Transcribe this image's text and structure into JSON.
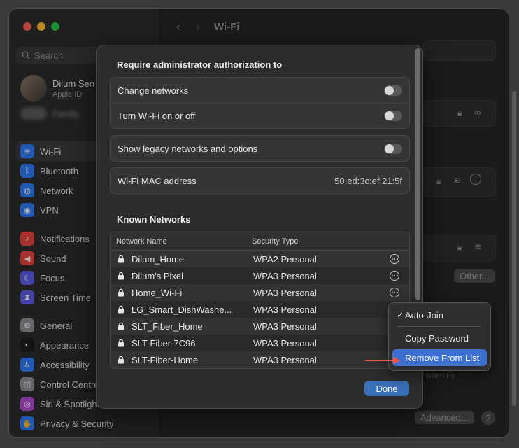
{
  "window": {
    "title": "Wi-Fi"
  },
  "sidebar": {
    "search_placeholder": "Search",
    "account": {
      "name": "Dilum Sen",
      "sub": "Apple ID"
    },
    "family": "Family",
    "groups": [
      [
        {
          "label": "Wi-Fi",
          "icon": "wifi-icon",
          "color": "#2e7bf6",
          "glyph": "≋",
          "active": true
        },
        {
          "label": "Bluetooth",
          "icon": "bluetooth-icon",
          "color": "#2e7bf6",
          "glyph": "ᛒ"
        },
        {
          "label": "Network",
          "icon": "globe-icon",
          "color": "#2e7bf6",
          "glyph": "◍"
        },
        {
          "label": "VPN",
          "icon": "vpn-icon",
          "color": "#2e7bf6",
          "glyph": "◉"
        }
      ],
      [
        {
          "label": "Notifications",
          "icon": "bell-icon",
          "color": "#e8453c",
          "glyph": "♪"
        },
        {
          "label": "Sound",
          "icon": "speaker-icon",
          "color": "#e8453c",
          "glyph": "◀"
        },
        {
          "label": "Focus",
          "icon": "moon-icon",
          "color": "#5e5ce6",
          "glyph": "☾"
        },
        {
          "label": "Screen Time",
          "icon": "hourglass-icon",
          "color": "#5e5ce6",
          "glyph": "⧗"
        }
      ],
      [
        {
          "label": "General",
          "icon": "gear-icon",
          "color": "#8e8e93",
          "glyph": "⚙"
        },
        {
          "label": "Appearance",
          "icon": "appearance-icon",
          "color": "#1c1c1e",
          "glyph": "◐"
        },
        {
          "label": "Accessibility",
          "icon": "accessibility-icon",
          "color": "#2e7bf6",
          "glyph": "♿"
        },
        {
          "label": "Control Centre",
          "icon": "control-centre-icon",
          "color": "#8e8e93",
          "glyph": "◫"
        },
        {
          "label": "Siri & Spotlight",
          "icon": "siri-icon",
          "color": "#b44bd6",
          "glyph": "◎"
        },
        {
          "label": "Privacy & Security",
          "icon": "hand-icon",
          "color": "#2e7bf6",
          "glyph": "✋"
        }
      ]
    ]
  },
  "background": {
    "other_button": "Other...",
    "advanced_button": "Advanced...",
    "help": "?",
    "faded_text": "when no"
  },
  "sheet": {
    "auth_title": "Require administrator authorization to",
    "auth_rows": [
      {
        "label": "Change networks"
      },
      {
        "label": "Turn Wi-Fi on or off"
      }
    ],
    "legacy_label": "Show legacy networks and options",
    "mac_label": "Wi-Fi MAC address",
    "mac_value": "50:ed:3c:ef:21:5f",
    "known_title": "Known Networks",
    "columns": {
      "name": "Network Name",
      "security": "Security Type"
    },
    "networks": [
      {
        "name": "Dilum_Home",
        "security": "WPA2 Personal",
        "more": true
      },
      {
        "name": "Dilum's Pixel",
        "security": "WPA3 Personal",
        "more": true
      },
      {
        "name": "Home_Wi-Fi",
        "security": "WPA3 Personal",
        "more": true
      },
      {
        "name": "LG_Smart_DishWashe...",
        "security": "WPA3 Personal",
        "more": false
      },
      {
        "name": "SLT_Fiber_Home",
        "security": "WPA3 Personal",
        "more": false
      },
      {
        "name": "SLT-Fiber-7C96",
        "security": "WPA3 Personal",
        "more": false
      },
      {
        "name": "SLT-Fiber-Home",
        "security": "WPA3 Personal",
        "more": false
      }
    ],
    "done_label": "Done"
  },
  "context_menu": {
    "auto_join": "Auto-Join",
    "checkmark": "✓",
    "copy_password": "Copy Password",
    "remove": "Remove From List"
  },
  "colors": {
    "accent": "#3a6fb9",
    "menu_highlight": "#3c6fd0",
    "annotation_arrow": "#e8574b"
  }
}
